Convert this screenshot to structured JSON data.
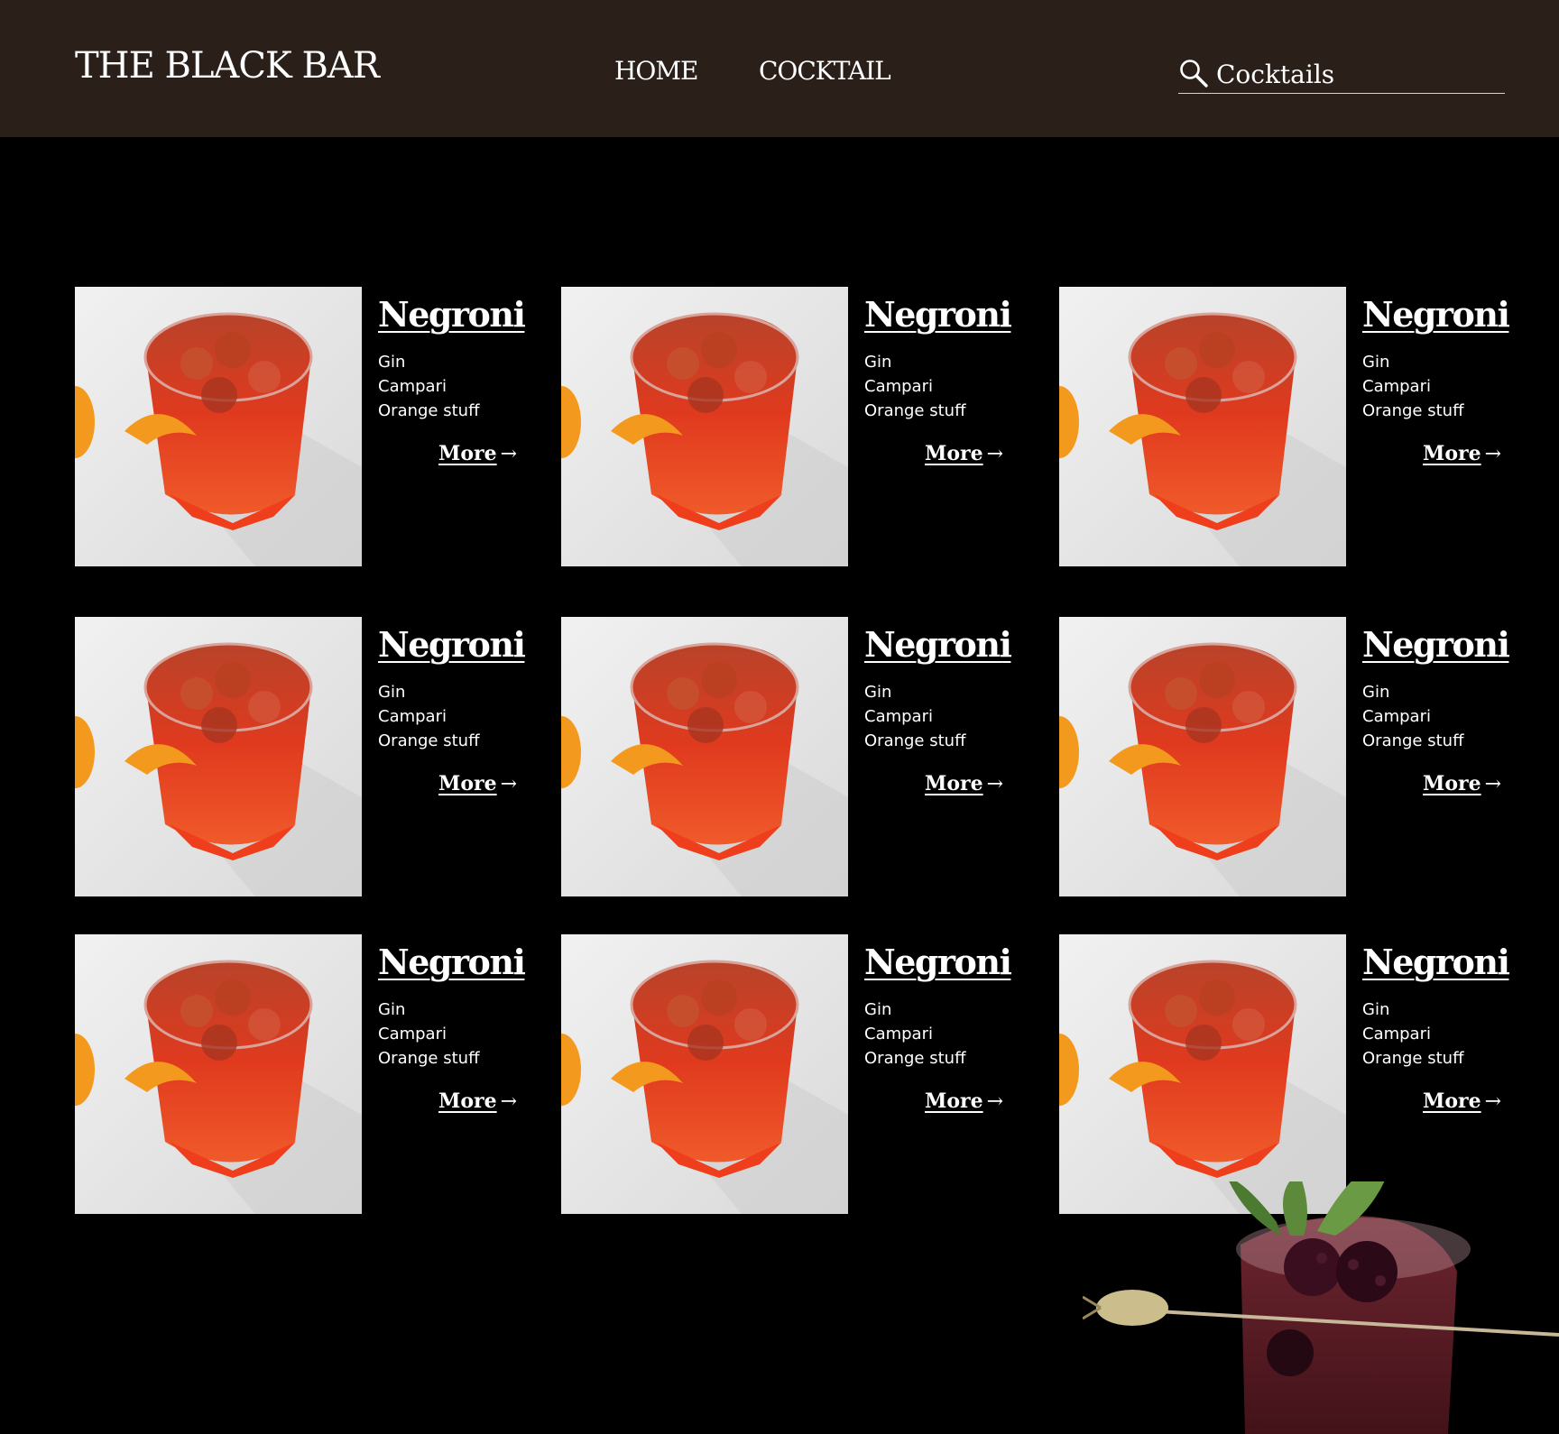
{
  "header": {
    "brand": "THE BLACK BAR",
    "nav": [
      {
        "label": "HOME"
      },
      {
        "label": "COCKTAIL"
      }
    ],
    "search": {
      "value": "",
      "placeholder": "Cocktails",
      "icon": "search-icon"
    }
  },
  "cards": [
    {
      "title": "Negroni",
      "ingredients": [
        "Gin",
        "Campari",
        "Orange stuff"
      ],
      "more": "More",
      "arrow": "→"
    },
    {
      "title": "Negroni",
      "ingredients": [
        "Gin",
        "Campari",
        "Orange stuff"
      ],
      "more": "More",
      "arrow": "→"
    },
    {
      "title": "Negroni",
      "ingredients": [
        "Gin",
        "Campari",
        "Orange stuff"
      ],
      "more": "More",
      "arrow": "→"
    },
    {
      "title": "Negroni",
      "ingredients": [
        "Gin",
        "Campari",
        "Orange stuff"
      ],
      "more": "More",
      "arrow": "→"
    },
    {
      "title": "Negroni",
      "ingredients": [
        "Gin",
        "Campari",
        "Orange stuff"
      ],
      "more": "More",
      "arrow": "→"
    },
    {
      "title": "Negroni",
      "ingredients": [
        "Gin",
        "Campari",
        "Orange stuff"
      ],
      "more": "More",
      "arrow": "→"
    },
    {
      "title": "Negroni",
      "ingredients": [
        "Gin",
        "Campari",
        "Orange stuff"
      ],
      "more": "More",
      "arrow": "→"
    },
    {
      "title": "Negroni",
      "ingredients": [
        "Gin",
        "Campari",
        "Orange stuff"
      ],
      "more": "More",
      "arrow": "→"
    },
    {
      "title": "Negroni",
      "ingredients": [
        "Gin",
        "Campari",
        "Orange stuff"
      ],
      "more": "More",
      "arrow": "→"
    }
  ],
  "colors": {
    "header_bg": "#2b1f1a",
    "page_bg": "#000000",
    "text": "#ffffff",
    "drink_red": "#d8301c",
    "orange_peel": "#f39a1e"
  }
}
